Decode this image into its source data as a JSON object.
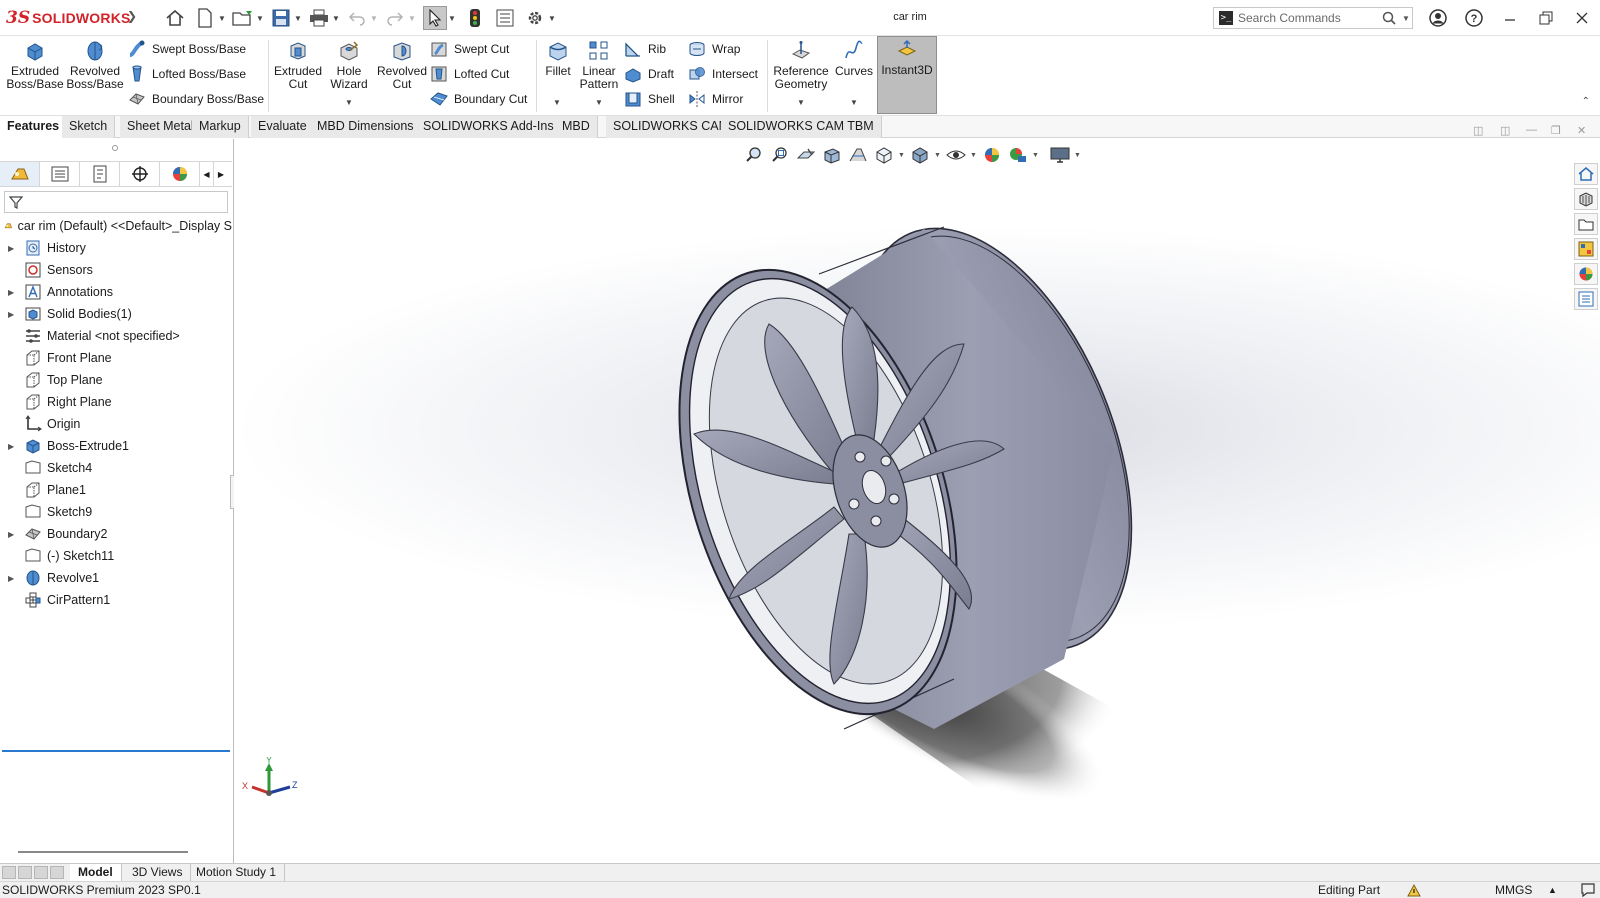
{
  "app": {
    "brand_ds": "3S",
    "brand_name": "SOLIDWORKS",
    "document_title": "car rim"
  },
  "search": {
    "placeholder": "Search Commands"
  },
  "command_manager": {
    "extruded_boss": "Extruded\nBoss/Base",
    "revolved_boss": "Revolved\nBoss/Base",
    "swept_boss": "Swept Boss/Base",
    "lofted_boss": "Lofted Boss/Base",
    "boundary_boss": "Boundary Boss/Base",
    "extruded_cut": "Extruded\nCut",
    "hole_wizard": "Hole\nWizard",
    "revolved_cut": "Revolved\nCut",
    "swept_cut": "Swept Cut",
    "lofted_cut": "Lofted Cut",
    "boundary_cut": "Boundary Cut",
    "fillet": "Fillet",
    "linear_pattern": "Linear\nPattern",
    "rib": "Rib",
    "draft": "Draft",
    "shell": "Shell",
    "wrap": "Wrap",
    "intersect": "Intersect",
    "mirror": "Mirror",
    "reference_geometry": "Reference\nGeometry",
    "curves": "Curves",
    "instant3d": "Instant3D"
  },
  "tabs": [
    "Features",
    "Sketch",
    "Sheet Metal",
    "Markup",
    "Evaluate",
    "MBD Dimensions",
    "SOLIDWORKS Add-Ins",
    "MBD",
    "SOLIDWORKS CAM",
    "SOLIDWORKS CAM TBM"
  ],
  "tree": {
    "root": "car rim (Default) <<Default>_Display S",
    "items": [
      {
        "label": "History",
        "expandable": true,
        "icon": "history-icon"
      },
      {
        "label": "Sensors",
        "expandable": false,
        "icon": "sensors-icon"
      },
      {
        "label": "Annotations",
        "expandable": true,
        "icon": "annotations-icon"
      },
      {
        "label": "Solid Bodies(1)",
        "expandable": true,
        "icon": "solid-bodies-icon"
      },
      {
        "label": "Material <not specified>",
        "expandable": false,
        "icon": "material-icon"
      },
      {
        "label": "Front Plane",
        "expandable": false,
        "icon": "plane-icon"
      },
      {
        "label": "Top Plane",
        "expandable": false,
        "icon": "plane-icon"
      },
      {
        "label": "Right Plane",
        "expandable": false,
        "icon": "plane-icon"
      },
      {
        "label": "Origin",
        "expandable": false,
        "icon": "origin-icon"
      },
      {
        "label": "Boss-Extrude1",
        "expandable": true,
        "icon": "boss-extrude-icon"
      },
      {
        "label": "Sketch4",
        "expandable": false,
        "icon": "sketch-icon"
      },
      {
        "label": "Plane1",
        "expandable": false,
        "icon": "plane-icon"
      },
      {
        "label": "Sketch9",
        "expandable": false,
        "icon": "sketch-icon"
      },
      {
        "label": "Boundary2",
        "expandable": true,
        "icon": "boundary-icon"
      },
      {
        "label": "(-) Sketch11",
        "expandable": false,
        "icon": "sketch-icon"
      },
      {
        "label": "Revolve1",
        "expandable": true,
        "icon": "revolve-icon"
      },
      {
        "label": "CirPattern1",
        "expandable": false,
        "icon": "circular-pattern-icon"
      }
    ]
  },
  "triad": {
    "x": "X",
    "y": "Y",
    "z": "Z"
  },
  "bottom_tabs": [
    "Model",
    "3D Views",
    "Motion Study 1"
  ],
  "status": {
    "product": "SOLIDWORKS Premium 2023 SP0.1",
    "mode": "Editing Part",
    "units": "MMGS",
    "units_caret": "▲"
  },
  "colors": {
    "brand": "#d2232a",
    "icon_blue": "#2f6db5",
    "rim_gray": "#8e90a3",
    "rollback": "#2b78d1"
  }
}
